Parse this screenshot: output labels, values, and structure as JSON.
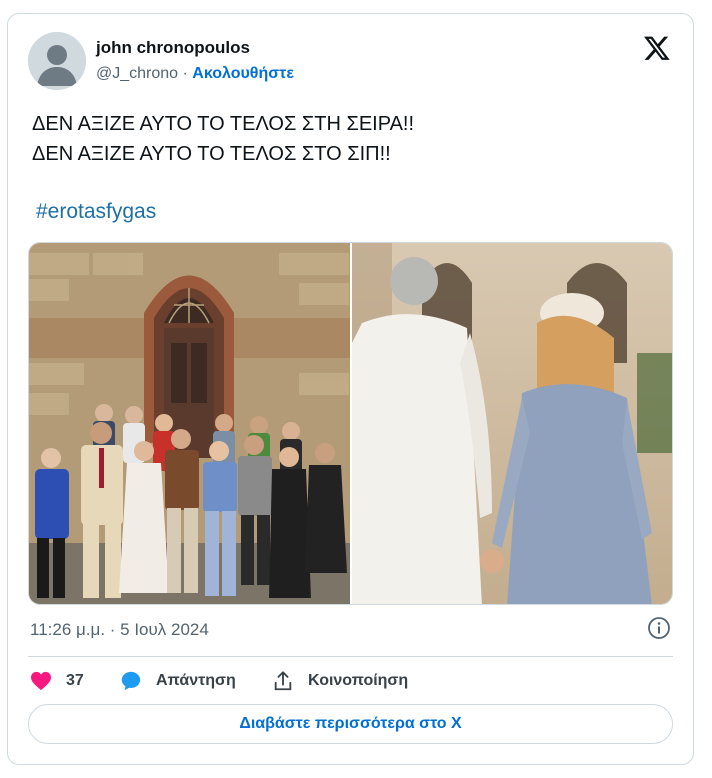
{
  "author": {
    "name": "john chronopoulos",
    "handle": "@J_chrono",
    "separator": "·",
    "follow_label": "Ακολουθήστε"
  },
  "tweet": {
    "line1": "ΔΕΝ ΑΞΙΖΕ ΑΥΤΟ ΤΟ ΤΕΛΟΣ ΣΤΗ ΣΕΙΡΑ!!",
    "line2": "ΔΕΝ ΑΞΙΖΕ ΑΥΤΟ ΤΟ ΤΕΛΟΣ ΣΤΟ ΣΙΠ!!",
    "hashtag": "#erotasfygas"
  },
  "media": {
    "photos": [
      {
        "description_icon": "group-photo"
      },
      {
        "description_icon": "couple-photo"
      }
    ]
  },
  "meta": {
    "timestamp": "11:26 μ.μ. · 5 Ιουλ 2024"
  },
  "actions": {
    "like_count": "37",
    "reply_label": "Απάντηση",
    "share_label": "Κοινοποίηση"
  },
  "footer": {
    "read_more_label": "Διαβάστε περισσότερα στο X"
  },
  "colors": {
    "link": "#006fd6",
    "hashtag": "#1d6fa5",
    "like": "#f91880",
    "reply": "#1d9bf0",
    "border": "#cfd9de",
    "muted": "#536471"
  }
}
